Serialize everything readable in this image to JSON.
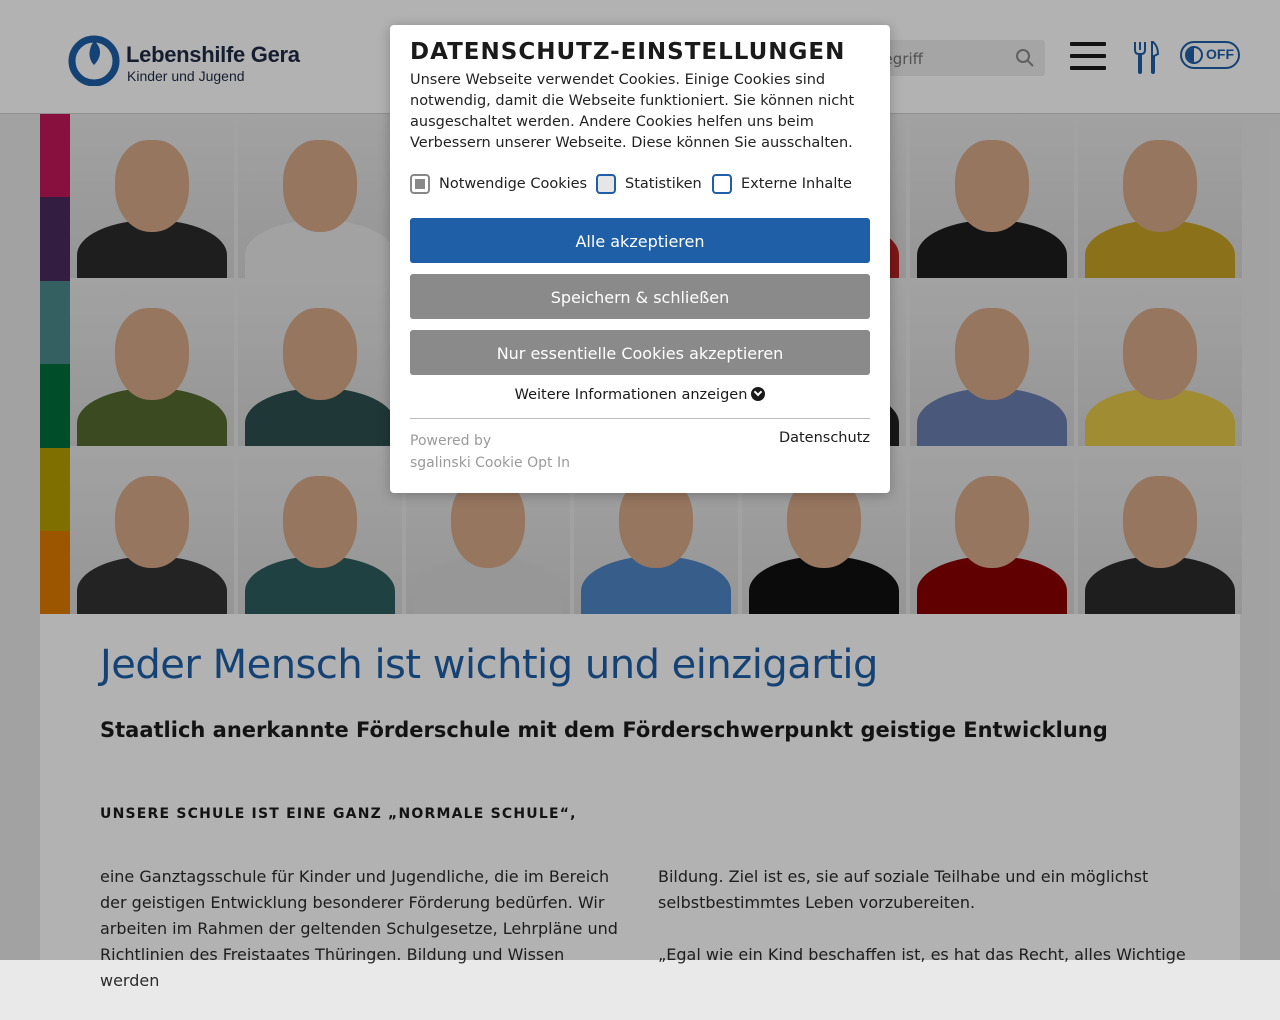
{
  "header": {
    "logo_title": "Lebenshilfe Gera",
    "logo_subtitle": "Kinder und Jugend",
    "search_placeholder": "begriff",
    "toggle_label": "OFF"
  },
  "main": {
    "headline": "Jeder Mensch ist wichtig und einzigartig",
    "subheadline": "Staatlich anerkannte Förderschule mit dem Förderschwerpunkt geistige Entwicklung",
    "section_title": "UNSERE SCHULE IST EINE GANZ „NORMALE SCHULE“,",
    "col1_text": "eine Ganztagsschule für Kinder und Jugendliche, die im Bereich der geistigen Entwicklung besonderer Förderung bedürfen. Wir arbeiten im Rahmen der geltenden Schulgesetze, Lehrpläne und Richtlinien des Freistaates Thüringen. Bildung und Wissen werden",
    "col2_para1": "Bildung. Ziel ist es, sie auf soziale Teilhabe und ein möglichst selbstbestimmtes Leben vorzubereiten.",
    "col2_para2": "„Egal wie ein Kind beschaffen ist, es hat das Recht, alles Wichtige"
  },
  "colors": {
    "accent": "#1f5fa8",
    "stripes": [
      "#c2185b",
      "#4a2c5e",
      "#4d8a8c",
      "#00703c",
      "#b59f00",
      "#e07b00"
    ]
  },
  "cookie_modal": {
    "title": "DATENSCHUTZ-EINSTELLUNGEN",
    "text": "Unsere Webseite verwendet Cookies. Einige Cookies sind notwendig, damit die Webseite funktioniert. Sie können nicht ausgeschaltet werden. Andere Cookies helfen uns beim Verbessern unserer Webseite. Diese können Sie ausschalten.",
    "checkboxes": [
      {
        "label": "Notwendige Cookies",
        "checked": true,
        "disabled": true
      },
      {
        "label": "Statistiken",
        "checked": false
      },
      {
        "label": "Externe Inhalte",
        "checked": false
      }
    ],
    "accept_all": "Alle akzeptieren",
    "save_close": "Speichern & schließen",
    "essential_only": "Nur essentielle Cookies akzeptieren",
    "more_info": "Weitere Informationen anzeigen",
    "powered_by": "Powered by",
    "powered_name": "sgalinski Cookie Opt In",
    "privacy_link": "Datenschutz"
  }
}
